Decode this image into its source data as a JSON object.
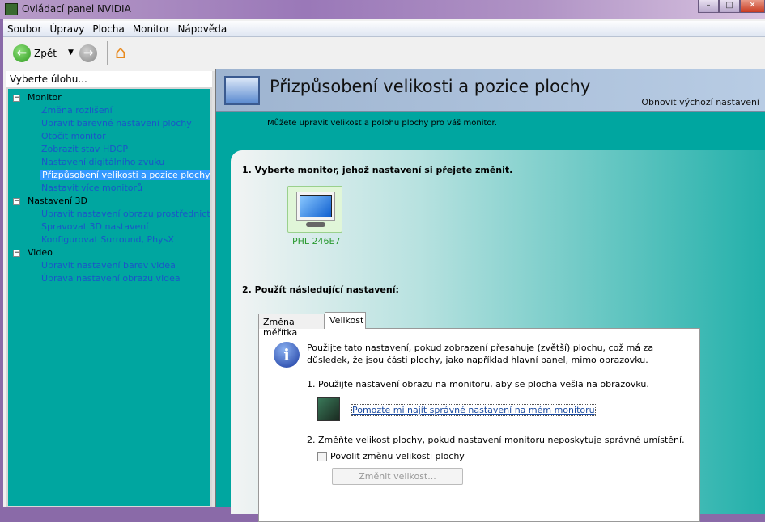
{
  "window": {
    "title": "Ovládací panel NVIDIA",
    "min": "–",
    "max": "□",
    "close": "✕"
  },
  "menu": [
    "Soubor",
    "Úpravy",
    "Plocha",
    "Monitor",
    "Nápověda"
  ],
  "toolbar": {
    "back": "Zpět"
  },
  "left": {
    "header": "Vyberte úlohu...",
    "groups": [
      {
        "label": "Monitor",
        "items": [
          "Změna rozlišení",
          "Upravit barevné nastavení plochy",
          "Otočit monitor",
          "Zobrazit stav HDCP",
          "Nastavení digitálního zvuku",
          "Přizpůsobení velikosti a pozice plochy",
          "Nastavit více monitorů"
        ]
      },
      {
        "label": "Nastavení 3D",
        "items": [
          "Upravit nastavení obrazu prostřednictvím n",
          "Spravovat 3D nastavení",
          "Konfigurovat Surround, PhysX"
        ]
      },
      {
        "label": "Video",
        "items": [
          "Upravit nastavení barev videa",
          "Úprava nastavení obrazu videa"
        ]
      }
    ]
  },
  "page": {
    "title": "Přizpůsobení velikosti a pozice plochy",
    "restore": "Obnovit výchozí nastavení",
    "subtitle": "Můžete upravit velikost a polohu plochy pro váš monitor.",
    "step1": "1. Vyberte monitor, jehož nastavení si přejete změnit.",
    "monitor": "PHL 246E7",
    "step2": "2. Použít následující nastavení:",
    "tabs": [
      "Změna měřítka",
      "Velikost"
    ],
    "info": "Použijte tato nastavení, pokud zobrazení přesahuje (zvětší) plochu, což má za důsledek, že jsou části plochy, jako například hlavní panel, mimo obrazovku.",
    "s1": "1. Použijte nastavení obrazu na monitoru, aby se plocha vešla na obrazovku.",
    "link": "Pomozte mi najít správné nastavení na mém monitoru",
    "s2": "2. Změňte velikost plochy, pokud nastavení monitoru neposkytuje správné umístění.",
    "checkbox": "Povolit změnu velikosti plochy",
    "button": "Změnit velikost..."
  }
}
